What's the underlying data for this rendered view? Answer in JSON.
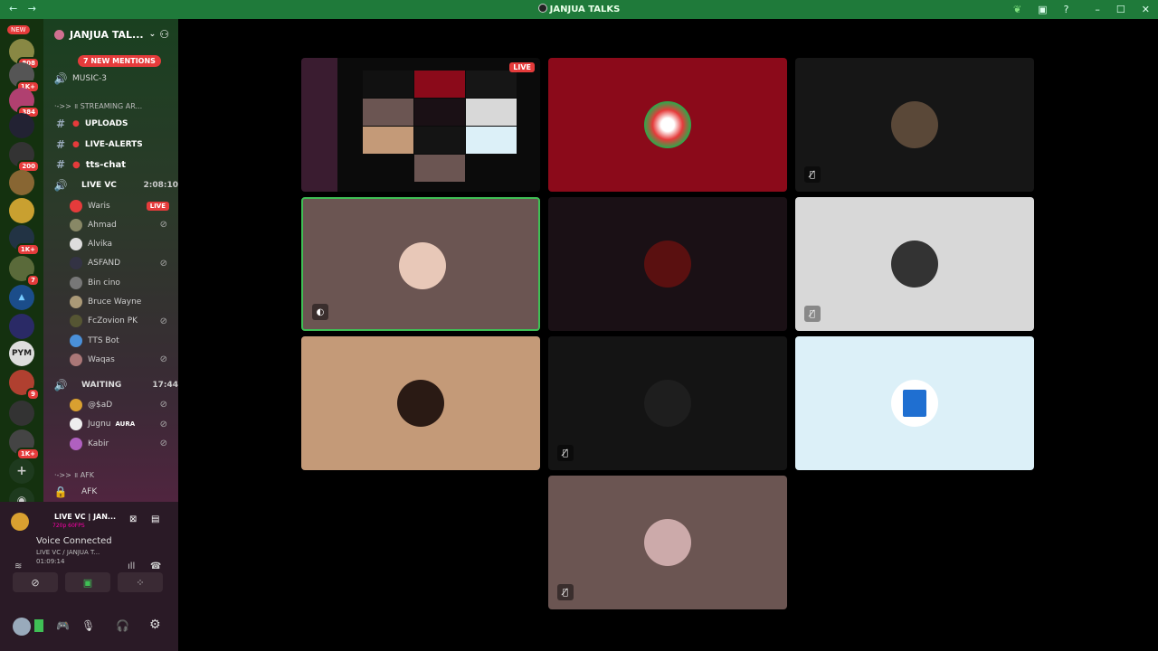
{
  "window": {
    "title": "JANJUA TALKS",
    "back_icon": "←",
    "forward_icon": "→",
    "controls": [
      "–",
      "☐",
      "✕"
    ]
  },
  "guild_list": {
    "new_label": "NEW",
    "badges": [
      "808",
      "1K+",
      "384",
      "200",
      "1K+",
      "7",
      "9",
      "1K+"
    ]
  },
  "server": {
    "name": "JANJUA TAL...",
    "new_mentions": "7 NEW MENTIONS"
  },
  "channels": {
    "music": "MUSIC-3",
    "streaming_category": "·->> ॥ STREAMING AR...",
    "uploads": "UPLOADS",
    "live_alerts": "LIVE-ALERTS",
    "tts_chat": "tts-chat",
    "live_vc": "LIVE VC",
    "live_vc_time": "2:08:10",
    "waiting": "WAITING",
    "waiting_time": "17:44",
    "afk_category": "·->> ॥ AFK",
    "afk": "AFK"
  },
  "live_vc_users": [
    {
      "name": "Waris",
      "live": "LIVE"
    },
    {
      "name": "Ahmad"
    },
    {
      "name": "Alvika"
    },
    {
      "name": "ASFAND"
    },
    {
      "name": "Bin cino"
    },
    {
      "name": "Bruce Wayne"
    },
    {
      "name": "FcZovion PK"
    },
    {
      "name": "TTS Bot"
    },
    {
      "name": "Waqas"
    }
  ],
  "waiting_users": [
    {
      "name": "@$aD"
    },
    {
      "name": "Jugnu",
      "tag": "AURA"
    },
    {
      "name": "Kabir"
    }
  ],
  "panel": {
    "stream_title": "LIVE VC | JAN...",
    "stream_quality": "720p 60FPS",
    "voice_status": "Voice Connected",
    "voice_channel": "LIVE VC / JANJUA T...",
    "voice_time": "01:09:14"
  },
  "tiles": {
    "live_badge": "LIVE"
  },
  "colors": {
    "titlebar": "#1f7a3a",
    "live": "#e53b3b",
    "speaking_border": "#3fbf55"
  }
}
